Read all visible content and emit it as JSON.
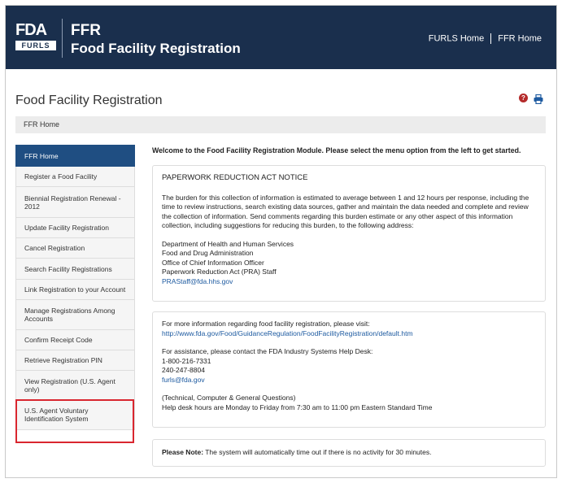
{
  "header": {
    "logo_top": "FDA",
    "logo_bottom": "FURLS",
    "app_abbr": "FFR",
    "app_title": "Food Facility Registration",
    "nav": [
      "FURLS Home",
      "FFR Home"
    ]
  },
  "page": {
    "title": "Food Facility Registration",
    "breadcrumb": "FFR Home",
    "help_icon_glyph": "?",
    "colors": {
      "header_bg": "#1a2f4d",
      "active_nav": "#1f4e82",
      "link": "#1d5aa0",
      "highlight": "#d9262f"
    }
  },
  "sidebar": {
    "items": [
      "FFR Home",
      "Register a Food Facility",
      "Biennial Registration Renewal - 2012",
      "Update Facility Registration",
      "Cancel Registration",
      "Search Facility Registrations",
      "Link Registration to your Account",
      "Manage Registrations Among Accounts",
      "Confirm Receipt Code",
      "Retrieve Registration PIN",
      "View Registration (U.S. Agent only)",
      "U.S. Agent Voluntary Identification System"
    ],
    "active_index": 0
  },
  "main": {
    "welcome": "Welcome to the Food Facility Registration Module. Please select the menu option from the left to get started.",
    "paperwork": {
      "title": "PAPERWORK REDUCTION ACT NOTICE",
      "body": "The burden for this collection of information is estimated to average between 1 and 12 hours per response, including the time to review instructions, search existing data sources, gather and maintain the data needed and complete and review the collection of information. Send comments regarding this burden estimate or any other aspect of this information collection, including suggestions for reducing this burden, to the following address:",
      "address": [
        "Department of Health and Human Services",
        "Food and Drug Administration",
        "Office of Chief Information Officer",
        "Paperwork Reduction Act (PRA) Staff"
      ],
      "email": "PRAStaff@fda.hhs.gov"
    },
    "info": {
      "more_info": "For more information regarding food facility registration, please visit:",
      "url": "http://www.fda.gov/Food/GuidanceRegulation/FoodFacilityRegistration/default.htm",
      "assistance": "For assistance, please contact the FDA Industry Systems Help Desk:",
      "phone1": "1-800-216-7331",
      "phone2": "240-247-8804",
      "email": "furls@fda.gov",
      "topics": "(Technical, Computer & General Questions)",
      "hours": "Help desk hours are Monday to Friday from 7:30 am to 11:00 pm Eastern Standard Time"
    },
    "note": {
      "label": "Please Note:",
      "text": " The system will automatically time out if there is no activity for 30 minutes."
    }
  }
}
